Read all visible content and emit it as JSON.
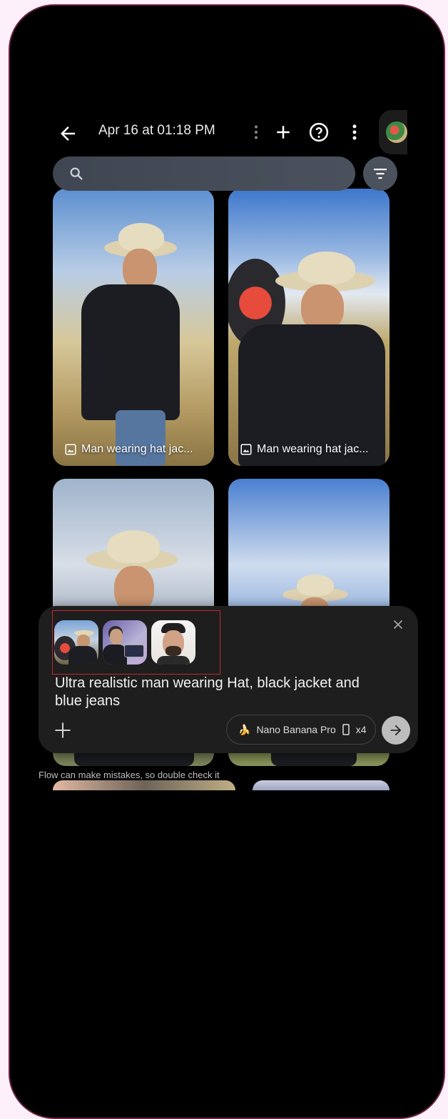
{
  "header": {
    "title": "Apr 16 at 01:18 PM"
  },
  "search": {
    "placeholder": ""
  },
  "grid": {
    "items": [
      {
        "caption": "Man wearing hat jac..."
      },
      {
        "caption": "Man wearing hat jac..."
      },
      {
        "caption": ""
      },
      {
        "caption": ""
      }
    ]
  },
  "prompt": {
    "text": "Ultra realistic man wearing Hat, black jacket and blue jeans",
    "model_emoji": "🍌",
    "model_label": "Nano Banana Pro",
    "count_label": "x4",
    "disclaimer": "Flow can make mistakes, so double check it"
  },
  "icons": {
    "back": "arrow-left-icon",
    "drag": "drag-handle-icon",
    "add": "plus-icon",
    "help": "help-icon",
    "more": "more-vert-icon",
    "search": "search-icon",
    "filter": "filter-icon",
    "close": "close-icon",
    "send": "arrow-right-icon",
    "aspect": "aspect-ratio-icon",
    "image": "image-icon"
  },
  "colors": {
    "background": "#000000",
    "frame": "#6b2141",
    "selection": "#c0282c"
  }
}
